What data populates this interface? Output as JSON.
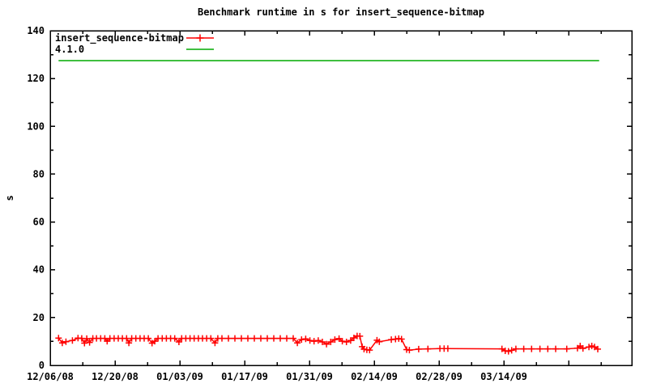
{
  "chart_data": {
    "type": "line",
    "title": "Benchmark runtime in s for insert_sequence-bitmap",
    "ylabel": "s",
    "xlabel": "",
    "grid": false,
    "legend_position": "top-left-inside",
    "x_unit": "days since 12/06/08",
    "x_axis": {
      "range_days": [
        0,
        125.65
      ],
      "major_ticks": [
        {
          "day": 0,
          "label": "12/06/08"
        },
        {
          "day": 14,
          "label": "12/20/08"
        },
        {
          "day": 28,
          "label": "01/03/09"
        },
        {
          "day": 42,
          "label": "01/17/09"
        },
        {
          "day": 56,
          "label": "01/31/09"
        },
        {
          "day": 70,
          "label": "02/14/09"
        },
        {
          "day": 84,
          "label": "02/28/09"
        },
        {
          "day": 98,
          "label": "03/14/09"
        },
        {
          "day": 112,
          "label": ""
        }
      ],
      "minor_tick_days": [
        7,
        21,
        35,
        49,
        63,
        77,
        91,
        105,
        119
      ]
    },
    "y_axis": {
      "range": [
        0,
        140
      ],
      "ticks": [
        0,
        20,
        40,
        60,
        80,
        100,
        120,
        140
      ],
      "minor_ticks": [
        10,
        30,
        50,
        70,
        90,
        110,
        130
      ]
    },
    "series": [
      {
        "name": "insert_sequence-bitmap",
        "color": "#ff0000",
        "style": "linespoints",
        "marker": "plus",
        "points": [
          [
            1.8,
            11.4
          ],
          [
            2.6,
            9.4
          ],
          [
            3.4,
            9.9
          ],
          [
            4.8,
            10.4
          ],
          [
            6.0,
            11.4
          ],
          [
            6.8,
            11.3
          ],
          [
            7.4,
            9.3
          ],
          [
            7.9,
            11.2
          ],
          [
            8.5,
            9.6
          ],
          [
            9.2,
            11.3
          ],
          [
            10.0,
            11.3
          ],
          [
            10.9,
            11.3
          ],
          [
            11.8,
            11.3
          ],
          [
            12.3,
            10.1
          ],
          [
            12.9,
            11.3
          ],
          [
            13.8,
            11.3
          ],
          [
            14.7,
            11.3
          ],
          [
            15.6,
            11.3
          ],
          [
            16.5,
            11.3
          ],
          [
            17.0,
            9.4
          ],
          [
            17.6,
            11.3
          ],
          [
            18.5,
            11.3
          ],
          [
            19.4,
            11.3
          ],
          [
            20.3,
            11.3
          ],
          [
            21.2,
            11.3
          ],
          [
            22.0,
            9.3
          ],
          [
            22.6,
            10.1
          ],
          [
            23.3,
            11.3
          ],
          [
            24.2,
            11.3
          ],
          [
            25.1,
            11.3
          ],
          [
            26.0,
            11.3
          ],
          [
            26.9,
            11.3
          ],
          [
            27.8,
            9.8
          ],
          [
            28.4,
            11.3
          ],
          [
            29.3,
            11.3
          ],
          [
            30.2,
            11.3
          ],
          [
            31.1,
            11.3
          ],
          [
            32.0,
            11.3
          ],
          [
            32.9,
            11.3
          ],
          [
            33.8,
            11.3
          ],
          [
            34.7,
            11.3
          ],
          [
            35.6,
            9.4
          ],
          [
            36.2,
            11.3
          ],
          [
            37.1,
            11.3
          ],
          [
            38.5,
            11.3
          ],
          [
            39.9,
            11.3
          ],
          [
            41.3,
            11.3
          ],
          [
            42.7,
            11.3
          ],
          [
            44.1,
            11.3
          ],
          [
            45.5,
            11.3
          ],
          [
            46.9,
            11.3
          ],
          [
            48.3,
            11.3
          ],
          [
            49.7,
            11.3
          ],
          [
            51.1,
            11.3
          ],
          [
            52.5,
            11.3
          ],
          [
            53.4,
            9.4
          ],
          [
            54.3,
            10.8
          ],
          [
            55.2,
            11.1
          ],
          [
            56.1,
            10.4
          ],
          [
            57.0,
            10.1
          ],
          [
            57.9,
            10.4
          ],
          [
            58.8,
            9.8
          ],
          [
            59.7,
            8.9
          ],
          [
            60.6,
            9.8
          ],
          [
            61.5,
            10.8
          ],
          [
            62.4,
            11.2
          ],
          [
            63.1,
            10.1
          ],
          [
            64.0,
            9.8
          ],
          [
            64.9,
            10.4
          ],
          [
            65.6,
            11.5
          ],
          [
            66.3,
            12.3
          ],
          [
            66.9,
            12.2
          ],
          [
            67.4,
            7.8
          ],
          [
            67.8,
            6.8
          ],
          [
            68.4,
            6.5
          ],
          [
            69.0,
            6.4
          ],
          [
            70.6,
            10.5
          ],
          [
            71.1,
            9.9
          ],
          [
            73.7,
            10.8
          ],
          [
            74.6,
            11.0
          ],
          [
            75.3,
            11.2
          ],
          [
            75.9,
            11.0
          ],
          [
            77.0,
            6.6
          ],
          [
            77.6,
            6.4
          ],
          [
            79.6,
            6.8
          ],
          [
            81.6,
            6.9
          ],
          [
            84.2,
            7.0
          ],
          [
            85.1,
            7.0
          ],
          [
            85.9,
            7.0
          ],
          [
            97.6,
            6.9
          ],
          [
            98.3,
            6.1
          ],
          [
            99.0,
            5.9
          ],
          [
            99.7,
            6.3
          ],
          [
            100.6,
            6.9
          ],
          [
            102.3,
            6.9
          ],
          [
            104.0,
            6.9
          ],
          [
            105.8,
            6.9
          ],
          [
            107.5,
            6.9
          ],
          [
            109.2,
            6.9
          ],
          [
            111.6,
            6.9
          ],
          [
            113.9,
            7.2
          ],
          [
            114.5,
            8.1
          ],
          [
            115.1,
            7.1
          ],
          [
            116.4,
            7.7
          ],
          [
            117.0,
            8.1
          ],
          [
            117.6,
            7.7
          ],
          [
            118.3,
            6.8
          ]
        ]
      },
      {
        "name": "4.1.0",
        "color": "#00aa00",
        "style": "line",
        "marker": "none",
        "points": [
          [
            1.8,
            127.5
          ],
          [
            118.6,
            127.5
          ]
        ]
      }
    ]
  },
  "colors": {
    "background": "#ffffff",
    "frame": "#000000",
    "text": "#000000"
  }
}
